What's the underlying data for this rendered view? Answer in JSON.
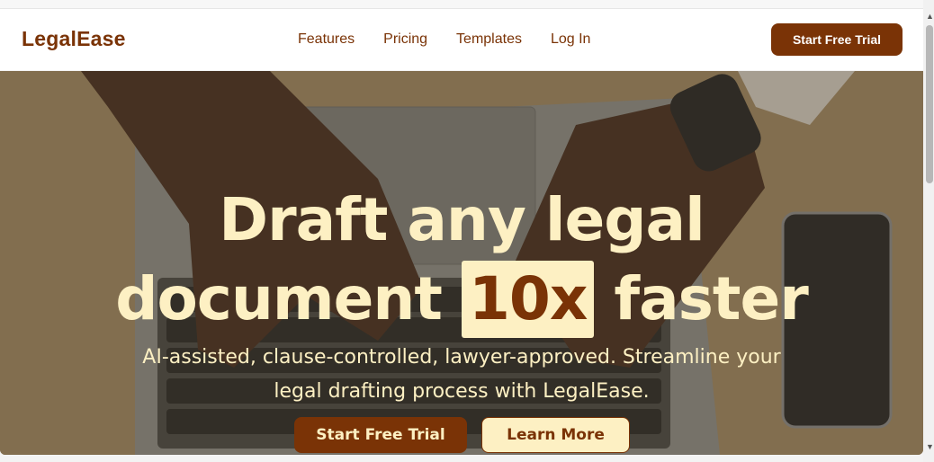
{
  "brand": "LegalEase",
  "nav": {
    "links": [
      "Features",
      "Pricing",
      "Templates",
      "Log In"
    ],
    "cta": "Start Free Trial"
  },
  "hero": {
    "headline_line1": "Draft any legal",
    "headline_line2_pre": "document",
    "headline_highlight": "10x",
    "headline_line2_post": "faster",
    "subtitle": "AI-assisted, clause-controlled, lawyer-approved. Streamline your legal drafting process with LegalEase.",
    "primary_button": "Start Free Trial",
    "secondary_button": "Learn More"
  },
  "colors": {
    "brand": "#7a3306",
    "cream": "#fdf0c3"
  },
  "scrollbar": {
    "up_icon": "▲",
    "down_icon": "▼"
  }
}
